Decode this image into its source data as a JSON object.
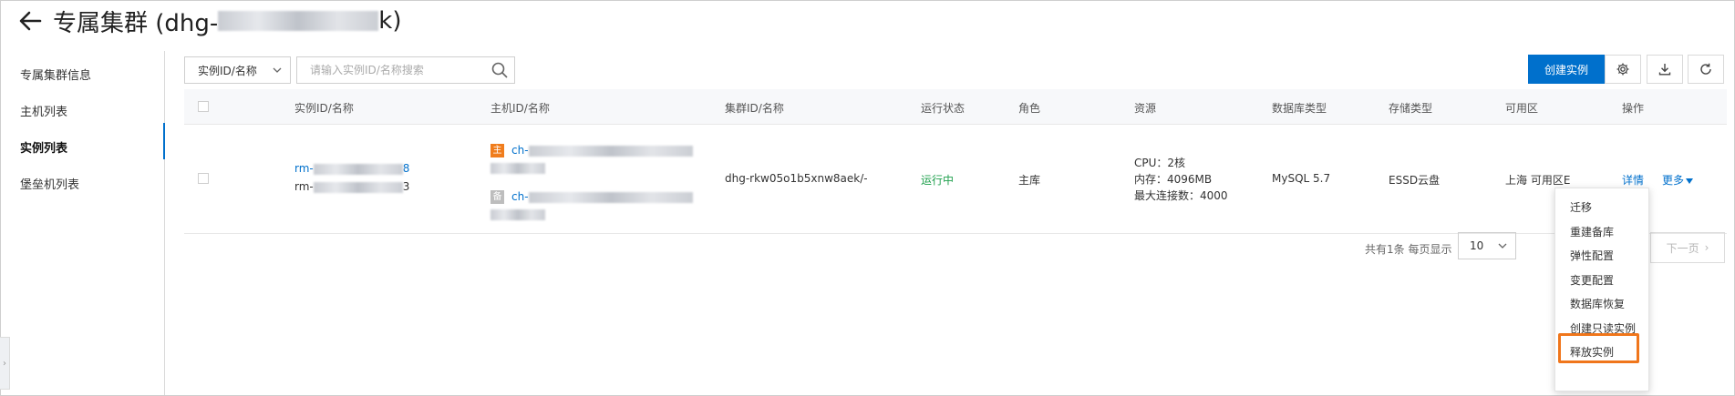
{
  "header": {
    "title_prefix": "专属集群 (dhg-",
    "title_suffix": "k)"
  },
  "sidebar": {
    "items": [
      {
        "label": "专属集群信息"
      },
      {
        "label": "主机列表"
      },
      {
        "label": "实例列表"
      },
      {
        "label": "堡垒机列表"
      }
    ],
    "active": "实例列表"
  },
  "toolbar": {
    "filter_select": "实例ID/名称",
    "search_placeholder": "请输入实例ID/名称搜索",
    "create_label": "创建实例",
    "icons": [
      "gear-icon",
      "download-icon",
      "refresh-icon"
    ]
  },
  "table": {
    "headers": [
      "实例ID/名称",
      "主机ID/名称",
      "集群ID/名称",
      "运行状态",
      "角色",
      "资源",
      "数据库类型",
      "存储类型",
      "可用区",
      "操作"
    ],
    "row": {
      "instance_id_prefix": "rm-",
      "instance_id_suffix": "8",
      "instance_name_prefix": "rm-",
      "instance_name_suffix": "3",
      "host_main_tag": "主",
      "host_main_prefix": "ch-",
      "host_backup_tag": "备",
      "host_backup_prefix": "ch-",
      "cluster": "dhg-rkw05o1b5xnw8aek/-",
      "status": "运行中",
      "role": "主库",
      "resource_cpu": "CPU：2核",
      "resource_mem": "内存：4096MB",
      "resource_conn": "最大连接数：4000",
      "db_type": "MySQL 5.7",
      "storage": "ESSD云盘",
      "zone": "上海 可用区E",
      "action_detail": "详情",
      "action_more": "更多"
    }
  },
  "pagination": {
    "summary": "共有1条 每页显示",
    "page_size": "10",
    "next_label": "下一页"
  },
  "more_menu": {
    "items": [
      "迁移",
      "重建备库",
      "弹性配置",
      "变更配置",
      "数据库恢复",
      "创建只读实例",
      "释放实例"
    ],
    "highlighted": "创建只读实例"
  },
  "colors": {
    "primary": "#0070cc",
    "status_running": "#1fa04d",
    "highlight": "#f0761b",
    "tag_main": "#f07d1d"
  }
}
